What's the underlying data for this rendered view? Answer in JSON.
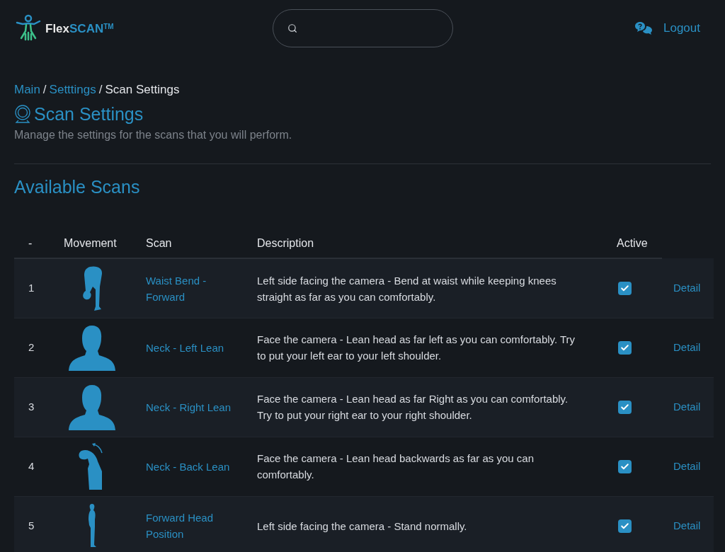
{
  "header": {
    "brand": {
      "prefix": "Flex",
      "accent": "SCAN",
      "mark": "TM"
    },
    "logout": "Logout"
  },
  "breadcrumb": {
    "separator": "/",
    "items": [
      {
        "label": "Main",
        "link": true
      },
      {
        "label": "Setttings",
        "link": true
      },
      {
        "label": "Scan Settings",
        "link": false
      }
    ]
  },
  "page": {
    "title": "Scan Settings",
    "description": "Manage the settings for the scans that you will perform."
  },
  "section": {
    "title": "Available Scans"
  },
  "table": {
    "columns": [
      "-",
      "Movement",
      "Scan",
      "Description",
      "Active"
    ],
    "rows": [
      {
        "number": "1",
        "kind": "bend",
        "scan": "Waist Bend - Forward",
        "description": "Left side facing the camera - Bend at waist while keeping knees straight as far as you can comfortably.",
        "checked": true,
        "action": "Detail"
      },
      {
        "number": "2",
        "kind": "bust",
        "scan": "Neck - Left Lean",
        "description": "Face the camera - Lean head as far left as you can comfortably. Try to put your left ear to your left shoulder.",
        "checked": true,
        "action": "Detail"
      },
      {
        "number": "3",
        "kind": "bust",
        "scan": "Neck - Right Lean",
        "description": "Face the camera - Lean head as far Right as you can comfortably. Try to put your right ear to your right shoulder.",
        "checked": true,
        "action": "Detail"
      },
      {
        "number": "4",
        "kind": "head-back",
        "scan": "Neck - Back Lean",
        "description": "Face the camera - Lean head backwards as far as you can comfortably.",
        "checked": true,
        "action": "Detail"
      },
      {
        "number": "5",
        "kind": "standing",
        "scan": "Forward Head Position",
        "description": "Left side facing the camera - Stand normally.",
        "checked": true,
        "action": "Detail"
      }
    ]
  }
}
